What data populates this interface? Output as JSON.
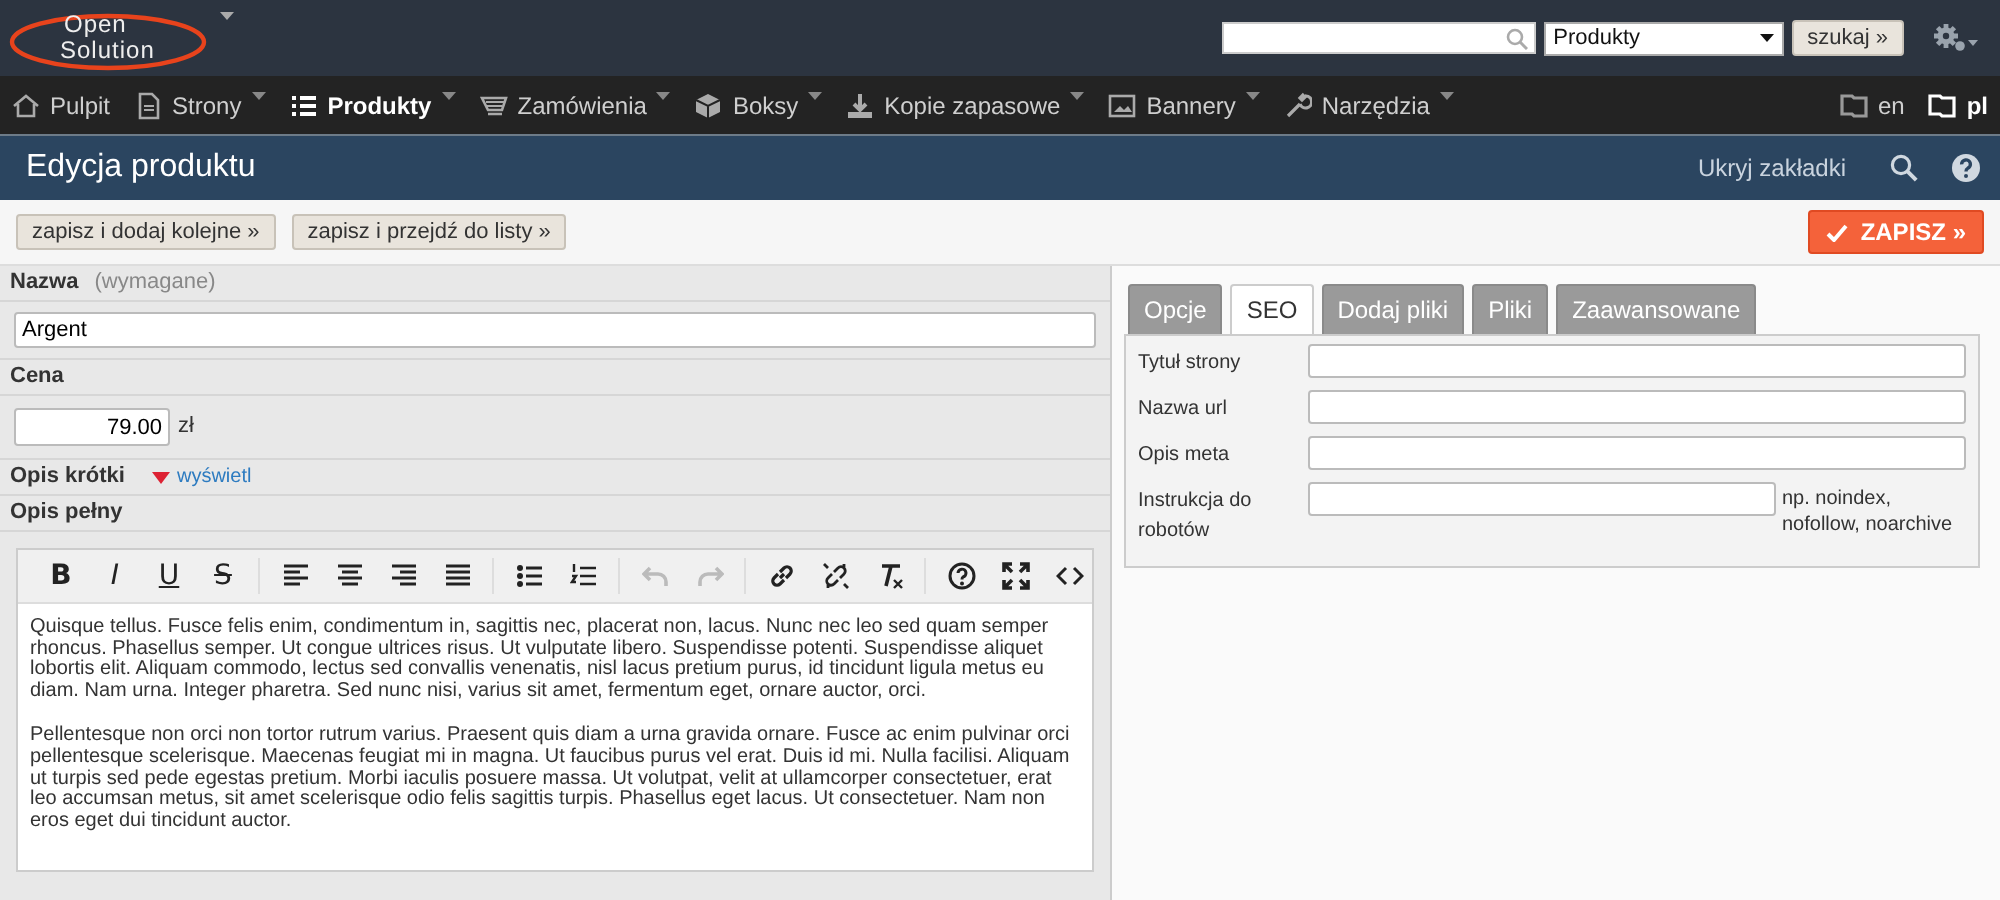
{
  "logo": {
    "lines": [
      "Open",
      "Solution"
    ],
    "dropdown": true
  },
  "search": {
    "scope": "Produkty",
    "button": "szukaj »"
  },
  "nav": [
    {
      "label": "Pulpit",
      "selected": false,
      "dropdown": false
    },
    {
      "label": "Strony",
      "selected": false,
      "dropdown": true
    },
    {
      "label": "Produkty",
      "selected": true,
      "dropdown": true
    },
    {
      "label": "Zamówienia",
      "selected": false,
      "dropdown": true
    },
    {
      "label": "Boksy",
      "selected": false,
      "dropdown": true
    },
    {
      "label": "Kopie zapasowe",
      "selected": false,
      "dropdown": true
    },
    {
      "label": "Bannery",
      "selected": false,
      "dropdown": true
    },
    {
      "label": "Narzędzia",
      "selected": false,
      "dropdown": true
    }
  ],
  "languages": [
    {
      "label": "en",
      "selected": false
    },
    {
      "label": "pl",
      "selected": true
    }
  ],
  "page_title": "Edycja produktu",
  "hide_tabs": "Ukryj zakładki",
  "actions": [
    "zapisz i dodaj kolejne »",
    "zapisz i przejdź do listy »"
  ],
  "save_button": "ZAPISZ »",
  "form": {
    "name": {
      "label": "Nazwa",
      "note": "(wymagane)",
      "value": "Argent"
    },
    "price": {
      "label": "Cena",
      "value": "79.00",
      "unit": "zł"
    },
    "short_description": {
      "label": "Opis krótki",
      "toggle": "wyświetl",
      "expanded": false
    },
    "full_description": {
      "label": "Opis pełny",
      "toolbar": [
        [
          {
            "kind": "bold",
            "label": "B",
            "disabled": false
          },
          {
            "kind": "italic",
            "label": "I",
            "disabled": false
          },
          {
            "kind": "underline",
            "label": "U",
            "disabled": false
          },
          {
            "kind": "strike",
            "label": "S",
            "disabled": false
          }
        ],
        [
          {
            "kind": "align-left",
            "disabled": false
          },
          {
            "kind": "align-center",
            "disabled": false
          },
          {
            "kind": "align-right",
            "disabled": false
          },
          {
            "kind": "justify",
            "disabled": false
          }
        ],
        [
          {
            "kind": "bullets",
            "disabled": false
          },
          {
            "kind": "numbers",
            "disabled": false
          }
        ],
        [
          {
            "kind": "undo",
            "disabled": true
          },
          {
            "kind": "redo",
            "disabled": true
          }
        ],
        [
          {
            "kind": "link",
            "disabled": false
          },
          {
            "kind": "unlink",
            "disabled": false
          },
          {
            "kind": "clear",
            "disabled": false
          }
        ],
        [
          {
            "kind": "help",
            "disabled": false
          },
          {
            "kind": "fullscreen",
            "disabled": false
          },
          {
            "kind": "code",
            "disabled": false
          }
        ]
      ],
      "paragraphs": [
        "Quisque tellus. Fusce felis enim, condimentum in, sagittis nec, placerat non, lacus. Nunc nec leo sed quam semper rhoncus. Phasellus semper. Ut congue ultrices risus. Ut vulputate libero. Suspendisse potenti. Suspendisse aliquet lobortis elit. Aliquam commodo, lectus sed convallis venenatis, nisl lacus pretium purus, id tincidunt ligula metus eu diam. Nam urna. Integer pharetra. Sed nunc nisi, varius sit amet, fermentum eget, ornare auctor, orci.",
        "Pellentesque non orci non tortor rutrum varius. Praesent quis diam a urna gravida ornare. Fusce ac enim pulvinar orci pellentesque scelerisque. Maecenas feugiat mi in magna. Ut faucibus purus vel erat. Duis id mi. Nulla facilisi. Aliquam ut turpis sed pede egestas pretium. Morbi iaculis posuere massa. Ut volutpat, velit at ullamcorper consectetuer, erat leo accumsan metus, sit amet scelerisque odio felis sagittis turpis. Phasellus eget lacus. Ut consectetuer. Nam non eros eget dui tincidunt auctor."
      ]
    }
  },
  "tabs": [
    {
      "label": "Opcje",
      "selected": false
    },
    {
      "label": "SEO",
      "selected": true
    },
    {
      "label": "Dodaj pliki",
      "selected": false
    },
    {
      "label": "Pliki",
      "selected": false
    },
    {
      "label": "Zaawansowane",
      "selected": false
    }
  ],
  "seo_fields": [
    {
      "label": "Tytuł strony"
    },
    {
      "label": "Nazwa url"
    },
    {
      "label": "Opis meta"
    },
    {
      "label": "Instrukcja do robotów",
      "hint": "np. noindex, nofollow, noarchive"
    }
  ]
}
